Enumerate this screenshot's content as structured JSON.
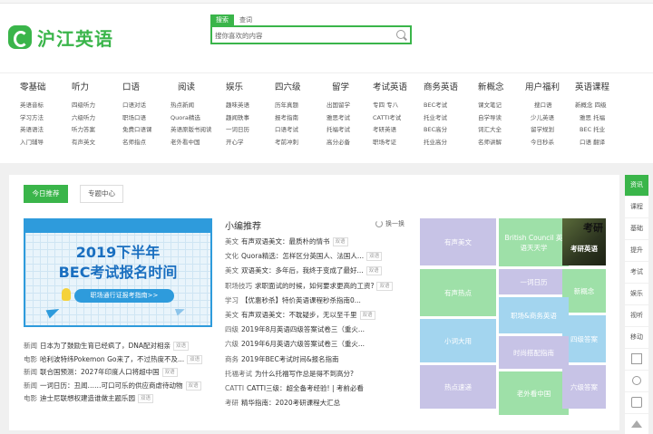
{
  "header": {
    "logo_text": "沪江英语",
    "search_tabs": [
      "搜索",
      "查词"
    ],
    "search_placeholder": "搜你喜欢的内容"
  },
  "nav": [
    {
      "head": "零基础",
      "items": [
        "英语音标",
        "学习方法",
        "英语语法",
        "入门辅导"
      ]
    },
    {
      "head": "听力",
      "items": [
        "四级听力",
        "六级听力",
        "听力答案",
        "有声英文"
      ]
    },
    {
      "head": "口语",
      "items": [
        "口语对话",
        "职场口语",
        "免费口语课",
        "名师指点"
      ]
    },
    {
      "head": "阅读",
      "items": [
        "热点新闻",
        "Quora精选",
        "英语原版书阅读",
        "老外看中国"
      ]
    },
    {
      "head": "娱乐",
      "items": [
        "趣味英语",
        "趣闻轶事",
        "一词日历",
        "开心学"
      ]
    },
    {
      "head": "四六级",
      "items": [
        "历年真题",
        "报考指南",
        "口语考试",
        "考前冲刺"
      ]
    },
    {
      "head": "留学",
      "items": [
        "出国留学",
        "雅思考试",
        "托福考试",
        "高分必备"
      ]
    },
    {
      "head": "考试英语",
      "items": [
        "专四 专八",
        "CATTI考试",
        "考研英语",
        "职场考证"
      ]
    },
    {
      "head": "商务英语",
      "items": [
        "BEC考试",
        "托业考试",
        "BEC高分",
        "托业高分"
      ]
    },
    {
      "head": "新概念",
      "items": [
        "课文笔记",
        "自学导读",
        "词汇大全",
        "名师讲解"
      ]
    },
    {
      "head": "用户福利",
      "items": [
        "搜口语",
        "少儿英语",
        "留学规划",
        "今日秒杀"
      ]
    },
    {
      "head": "英语课程",
      "items": [
        "新概念 四级",
        "雅思 托福",
        "BEC 托业",
        "口语 翻译"
      ]
    }
  ],
  "tabs": [
    "今日推荐",
    "专题中心"
  ],
  "banner": {
    "line1": "2019下半年",
    "line2": "BEC考试报名时间",
    "cta": "职场通行证报考指南>>"
  },
  "tag_label": "双语",
  "news_left": [
    {
      "cat": "新闻",
      "text": "日本为了鼓励生育已经疯了，DNA配对相亲",
      "tag": true
    },
    {
      "cat": "电影",
      "text": "哈利波特纬Pokemon Go来了，不过热度不及...",
      "tag": true
    },
    {
      "cat": "新闻",
      "text": "联合国预测：2027年印度人口将超中国",
      "tag": true
    },
    {
      "cat": "新闻",
      "text": "一词日历：丑闻……可口可乐的供应商虐待动物",
      "tag": true
    },
    {
      "cat": "电影",
      "text": "迪士尼联想权建造谁做主题乐园",
      "tag": true
    }
  ],
  "recommend": {
    "title": "小编推荐",
    "refresh": "换一换",
    "items": [
      {
        "cat": "美文",
        "text": "有声双语美文：最质朴的情书",
        "tag": true
      },
      {
        "cat": "文化",
        "text": "Quora精选：怎样区分英国人、法国人...",
        "tag": true
      },
      {
        "cat": "美文",
        "text": "双语美文：多年后，我终于变成了最好...",
        "tag": true
      },
      {
        "cat": "职场技巧",
        "text": "求职面试的时候，如何要求更高的工资?",
        "tag": true
      },
      {
        "cat": "学习",
        "text": "【优惠秒杀】特价英语课程秒杀指南0...",
        "tag": false
      },
      {
        "cat": "美文",
        "text": "有声双语美文：不耽疑步，无以至千里",
        "tag": true
      },
      {
        "cat": "四级",
        "text": "2019年8月英语四级答案试卷三（重火...",
        "tag": false
      },
      {
        "cat": "六级",
        "text": "2019年6月英语六级答案试卷三（重火...",
        "tag": false
      },
      {
        "cat": "商务",
        "text": "2019年BEC考试时间&报名指南",
        "tag": false
      },
      {
        "cat": "托福考试",
        "text": "为什么托福写作总是得不到高分?",
        "tag": false
      },
      {
        "cat": "CATTI",
        "text": "CATTI三级：超全备考经验! | 考前必看",
        "tag": false
      },
      {
        "cat": "考研",
        "text": "精华指南：2020考研课程大汇总",
        "tag": false
      }
    ]
  },
  "tiles": {
    "t1": "有声美文",
    "t2": "British Council 英语天天学",
    "t3_big": "考研",
    "t3": "考研英语",
    "t4": "一词日历",
    "t5": "有声热点",
    "t6": "新概念",
    "t7": "职场&商务英语",
    "t8": "小词大用",
    "t9": "四级答案",
    "t10": "时尚搭配指南",
    "t11": "热点速递",
    "t12": "老外看中国",
    "t13": "六级答案"
  },
  "colors": {
    "green": "#3ab54a",
    "tile_purple": "#c7c3e6",
    "tile_green": "#9ee0a8",
    "tile_blue": "#a3d5ef"
  },
  "sidebar": [
    "资讯",
    "课程",
    "基础",
    "提升",
    "考试",
    "娱乐",
    "视听",
    "移动"
  ],
  "sidebar_icons": [
    "qrcode-icon",
    "share-icon",
    "edit-icon",
    "up-icon"
  ]
}
